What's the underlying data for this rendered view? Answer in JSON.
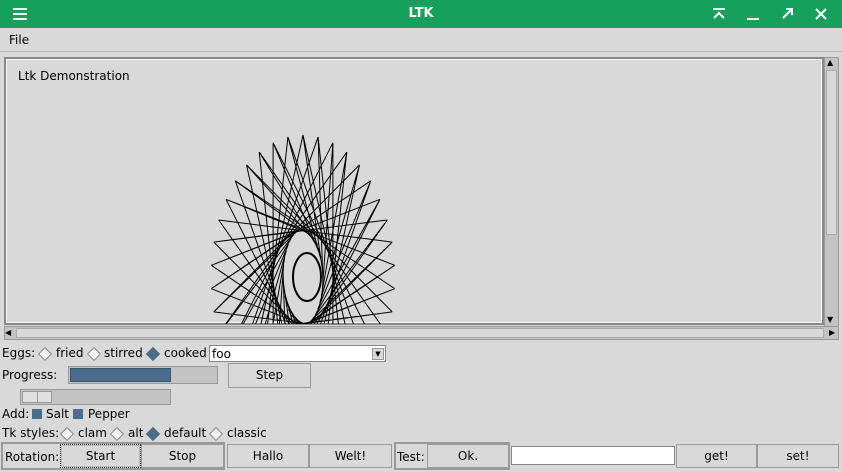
{
  "window": {
    "title": "LTK"
  },
  "menu": {
    "file": "File"
  },
  "canvas": {
    "title": "Ltk Demonstration"
  },
  "eggs": {
    "label": "Eggs:",
    "options": [
      "fried",
      "stirred",
      "cooked"
    ],
    "selected": "cooked",
    "combo_value": "foo"
  },
  "progress": {
    "label": "Progress:",
    "value_fraction": 0.69,
    "step_label": "Step"
  },
  "scale": {
    "value_fraction": 0.0
  },
  "add": {
    "label": "Add:",
    "salt": "Salt",
    "pepper": "Pepper"
  },
  "tk_styles": {
    "label": "Tk styles:",
    "options": [
      "clam",
      "alt",
      "default",
      "classic"
    ],
    "selected": "default"
  },
  "rotation": {
    "label": "Rotation:",
    "start": "Start",
    "stop": "Stop"
  },
  "buttons": {
    "hallo": "Hallo",
    "welt": "Welt!"
  },
  "test": {
    "label": "Test:",
    "ok": "Ok.",
    "entry_value": "",
    "get": "get!",
    "set": "set!"
  },
  "colors": {
    "titlebar": "#17a05c",
    "accent": "#4d6b8a",
    "background": "#d9d9d9"
  }
}
